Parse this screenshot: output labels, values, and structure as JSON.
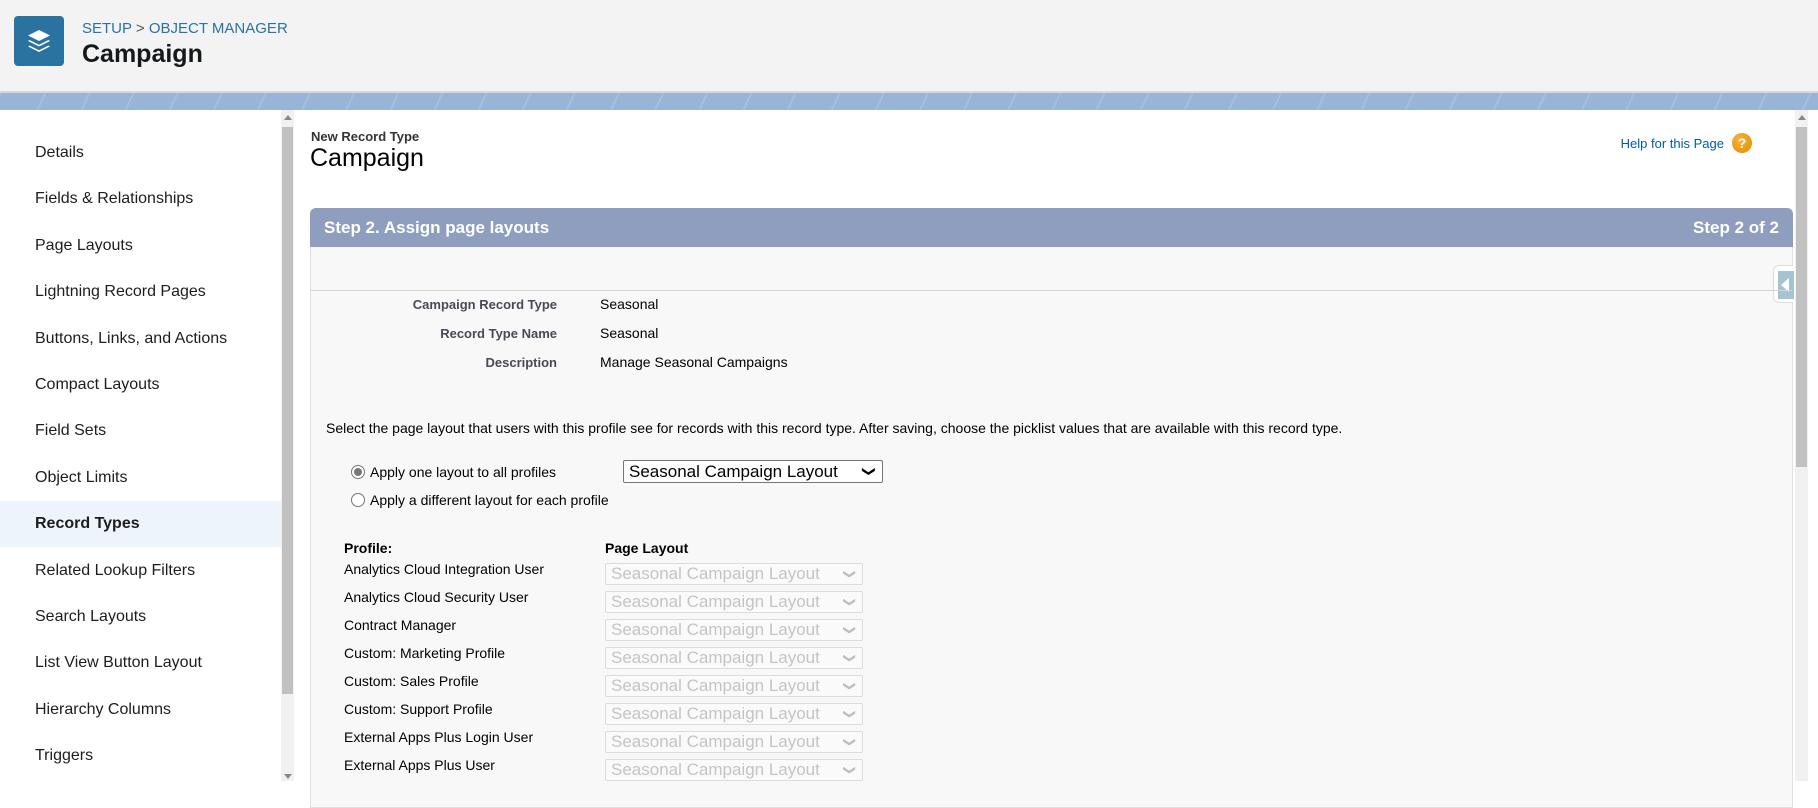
{
  "header": {
    "breadcrumb_setup": "SETUP",
    "breadcrumb_sep": ">",
    "breadcrumb_object_manager": "OBJECT MANAGER",
    "title": "Campaign",
    "icon": "layers-icon",
    "accent": "#2a73a1"
  },
  "sidebar": {
    "items": [
      {
        "label": "Details"
      },
      {
        "label": "Fields & Relationships"
      },
      {
        "label": "Page Layouts"
      },
      {
        "label": "Lightning Record Pages"
      },
      {
        "label": "Buttons, Links, and Actions"
      },
      {
        "label": "Compact Layouts"
      },
      {
        "label": "Field Sets"
      },
      {
        "label": "Object Limits"
      },
      {
        "label": "Record Types",
        "active": true
      },
      {
        "label": "Related Lookup Filters"
      },
      {
        "label": "Search Layouts"
      },
      {
        "label": "List View Button Layout"
      },
      {
        "label": "Hierarchy Columns"
      },
      {
        "label": "Triggers"
      }
    ]
  },
  "main": {
    "subtitle": "New Record Type",
    "title": "Campaign",
    "help_link": "Help for this Page",
    "step_title": "Step 2. Assign page layouts",
    "step_count": "Step 2 of 2",
    "details": [
      {
        "label": "Campaign Record Type",
        "value": "Seasonal"
      },
      {
        "label": "Record Type Name",
        "value": "Seasonal"
      },
      {
        "label": "Description",
        "value": "Manage Seasonal Campaigns"
      }
    ],
    "instruction": "Select the page layout that users with this profile see for records with this record type. After saving, choose the picklist values that are available with this record type.",
    "radio_all": {
      "label": "Apply one layout to all profiles",
      "checked": true
    },
    "radio_each": {
      "label": "Apply a different layout for each profile",
      "checked": false
    },
    "all_layout_select": "Seasonal Campaign Layout",
    "profile_header": "Profile:",
    "layout_header": "Page Layout",
    "profiles": [
      {
        "name": "Analytics Cloud Integration User",
        "layout": "Seasonal Campaign Layout"
      },
      {
        "name": "Analytics Cloud Security User",
        "layout": "Seasonal Campaign Layout"
      },
      {
        "name": "Contract Manager",
        "layout": "Seasonal Campaign Layout"
      },
      {
        "name": "Custom: Marketing Profile",
        "layout": "Seasonal Campaign Layout"
      },
      {
        "name": "Custom: Sales Profile",
        "layout": "Seasonal Campaign Layout"
      },
      {
        "name": "Custom: Support Profile",
        "layout": "Seasonal Campaign Layout"
      },
      {
        "name": "External Apps Plus Login User",
        "layout": "Seasonal Campaign Layout"
      },
      {
        "name": "External Apps Plus User",
        "layout": "Seasonal Campaign Layout"
      }
    ]
  }
}
